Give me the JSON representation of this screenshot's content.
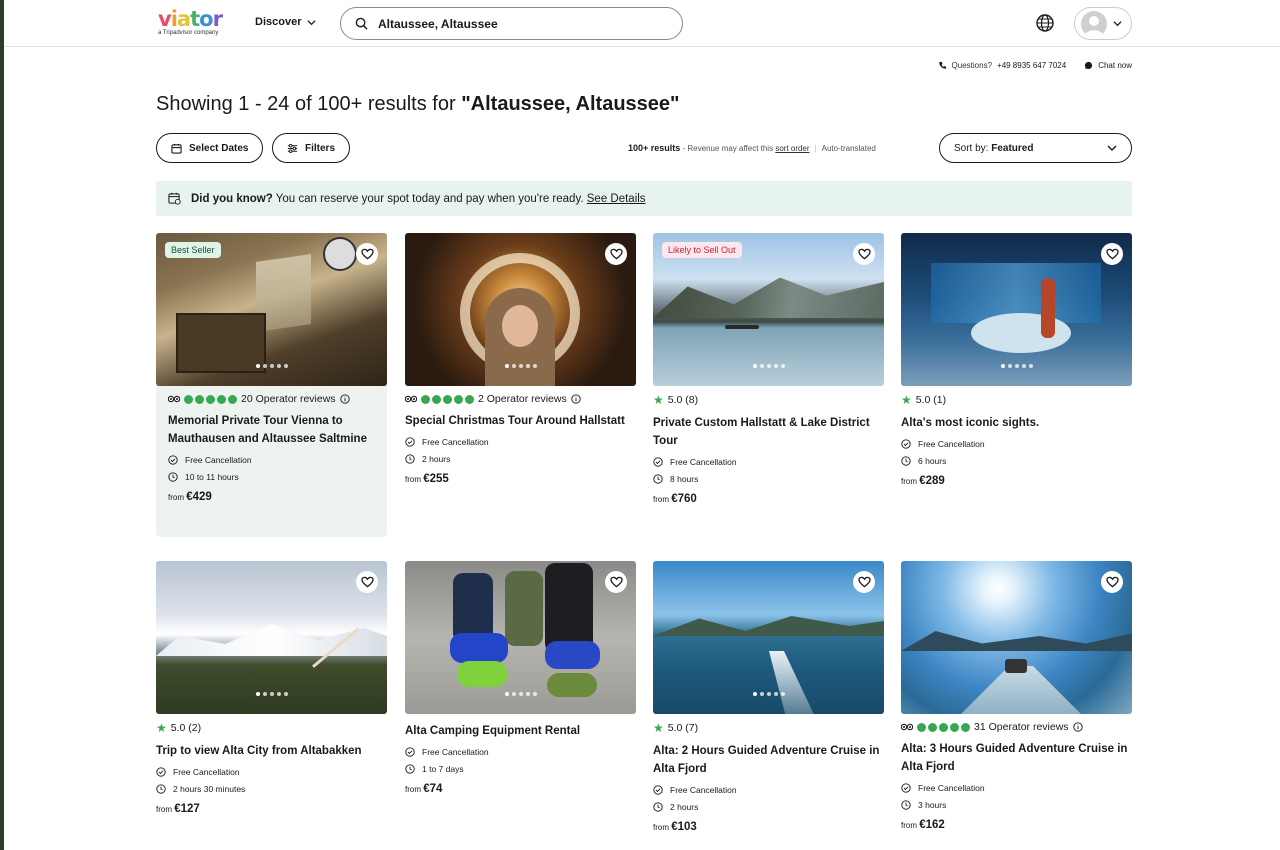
{
  "header": {
    "logo_text": "viator",
    "logo_sub": "a Tripadvisor company",
    "discover_label": "Discover",
    "search_value": "Altaussee, Altaussee"
  },
  "contact": {
    "questions_label": "Questions?",
    "phone": "+49 8935 647 7024",
    "chat_label": "Chat now"
  },
  "title": {
    "prefix": "Showing 1 - 24 of 100+ results for ",
    "query": "\"Altaussee, Altaussee\""
  },
  "filters": {
    "select_dates": "Select Dates",
    "filters": "Filters",
    "result_count": "100+ results",
    "revenue_note": " - Revenue may affect this ",
    "sort_order_link": "sort order",
    "auto_translated": "Auto-translated",
    "sort_prefix": "Sort by: ",
    "sort_value": "Featured"
  },
  "banner": {
    "bold": "Did you know?",
    "text": " You can reserve your spot today and pay when you're ready. ",
    "link": "See Details"
  },
  "cards": [
    {
      "badge": "Best Seller",
      "rating_text": "20 Operator reviews",
      "title": "Memorial Private Tour Vienna to Mauthausen and Altaussee Saltmine",
      "cancel": "Free Cancellation",
      "duration": "10 to 11 hours",
      "from": "from ",
      "price": "€429"
    },
    {
      "rating_text": "2 Operator reviews",
      "title": "Special Christmas Tour Around Hallstatt",
      "cancel": "Free Cancellation",
      "duration": "2 hours",
      "from": "from ",
      "price": "€255"
    },
    {
      "badge": "Likely to Sell Out",
      "rating_text": "5.0 (8)",
      "title": "Private Custom Hallstatt & Lake District Tour",
      "cancel": "Free Cancellation",
      "duration": "8 hours",
      "from": "from ",
      "price": "€760"
    },
    {
      "rating_text": "5.0 (1)",
      "title": "Alta's most iconic sights.",
      "cancel": "Free Cancellation",
      "duration": "6 hours",
      "from": "from ",
      "price": "€289"
    },
    {
      "rating_text": "5.0 (2)",
      "title": "Trip to view Alta City from Altabakken",
      "cancel": "Free Cancellation",
      "duration": "2 hours 30 minutes",
      "from": "from ",
      "price": "€127"
    },
    {
      "title": "Alta Camping Equipment Rental",
      "cancel": "Free Cancellation",
      "duration": "1 to 7 days",
      "from": "from ",
      "price": "€74"
    },
    {
      "rating_text": "5.0 (7)",
      "title": "Alta: 2 Hours Guided Adventure Cruise in Alta Fjord",
      "cancel": "Free Cancellation",
      "duration": "2 hours",
      "from": "from ",
      "price": "€103"
    },
    {
      "rating_text": "31 Operator reviews",
      "title": "Alta: 3 Hours Guided Adventure Cruise in Alta Fjord",
      "cancel": "Free Cancellation",
      "duration": "3 hours",
      "from": "from ",
      "price": "€162"
    }
  ],
  "colors": {
    "accent_green": "#34a853",
    "banner_bg": "#e7f3ee",
    "sell_out": "#c4243f"
  }
}
